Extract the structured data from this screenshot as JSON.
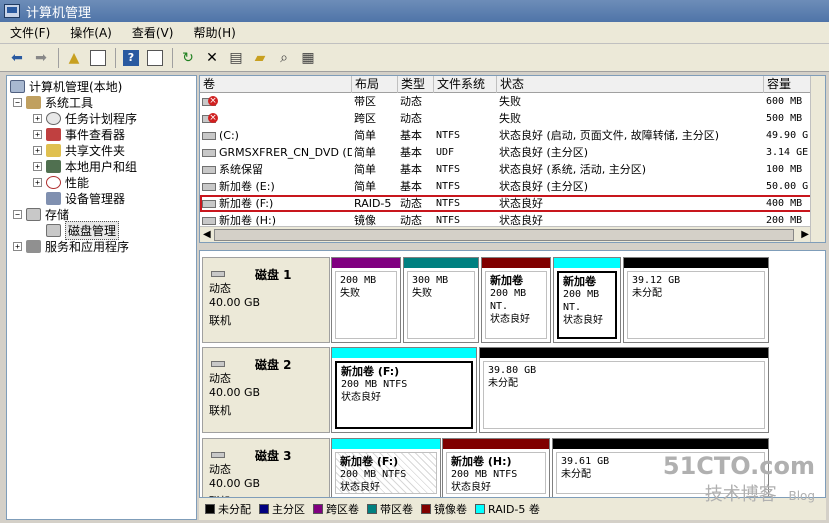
{
  "window": {
    "title": "计算机管理"
  },
  "menu": [
    "文件(F)",
    "操作(A)",
    "查看(V)",
    "帮助(H)"
  ],
  "toolbar": {
    "icons": [
      "back-arrow-icon",
      "forward-arrow-icon",
      "up-folder-icon",
      "console-tree-icon",
      "help-icon",
      "properties-pane-icon",
      "refresh-icon",
      "delete-icon",
      "properties-icon",
      "open-folder-icon",
      "search-icon",
      "export-icon"
    ]
  },
  "tree": {
    "items": [
      {
        "label": "计算机管理(本地)",
        "icon": "computer-management-icon"
      },
      {
        "label": "系统工具",
        "icon": "tools-icon",
        "expander": "−"
      },
      {
        "label": "任务计划程序",
        "icon": "clock-icon",
        "expander": "+"
      },
      {
        "label": "事件查看器",
        "icon": "event-viewer-icon",
        "expander": "+"
      },
      {
        "label": "共享文件夹",
        "icon": "shared-folder-icon",
        "expander": "+"
      },
      {
        "label": "本地用户和组",
        "icon": "users-icon",
        "expander": "+"
      },
      {
        "label": "性能",
        "icon": "performance-icon",
        "expander": "+"
      },
      {
        "label": "设备管理器",
        "icon": "device-manager-icon"
      },
      {
        "label": "存储",
        "icon": "storage-icon",
        "expander": "−"
      },
      {
        "label": "磁盘管理",
        "icon": "disk-management-icon"
      },
      {
        "label": "服务和应用程序",
        "icon": "services-icon",
        "expander": "+"
      }
    ]
  },
  "volumes": {
    "columns": [
      "卷",
      "布局",
      "类型",
      "文件系统",
      "状态",
      "容量"
    ],
    "rows": [
      {
        "name": "",
        "layout": "带区",
        "type": "动态",
        "fs": "",
        "status": "失败",
        "capacity": "600 MB",
        "error": true
      },
      {
        "name": "",
        "layout": "跨区",
        "type": "动态",
        "fs": "",
        "status": "失败",
        "capacity": "500 MB",
        "error": true
      },
      {
        "name": "(C:)",
        "layout": "简单",
        "type": "基本",
        "fs": "NTFS",
        "status": "状态良好 (启动, 页面文件, 故障转储, 主分区)",
        "capacity": "49.90 G"
      },
      {
        "name": "GRMSXFRER_CN_DVD (D:)",
        "layout": "简单",
        "type": "基本",
        "fs": "UDF",
        "status": "状态良好 (主分区)",
        "capacity": "3.14 GE"
      },
      {
        "name": "系统保留",
        "layout": "简单",
        "type": "基本",
        "fs": "NTFS",
        "status": "状态良好 (系统, 活动, 主分区)",
        "capacity": "100 MB"
      },
      {
        "name": "新加卷 (E:)",
        "layout": "简单",
        "type": "基本",
        "fs": "NTFS",
        "status": "状态良好 (主分区)",
        "capacity": "50.00 G"
      },
      {
        "name": "新加卷 (F:)",
        "layout": "RAID-5",
        "type": "动态",
        "fs": "NTFS",
        "status": "状态良好",
        "capacity": "400 MB",
        "highlighted": true
      },
      {
        "name": "新加卷 (H:)",
        "layout": "镜像",
        "type": "动态",
        "fs": "NTFS",
        "status": "状态良好",
        "capacity": "200 MB"
      }
    ]
  },
  "disks": [
    {
      "name": "磁盘 1",
      "type": "动态",
      "size": "40.00 GB",
      "state": "联机",
      "partitions": [
        {
          "title": "",
          "line1": "200 MB",
          "line2": "失败",
          "color": "#800080"
        },
        {
          "title": "",
          "line1": "300 MB",
          "line2": "失败",
          "color": "#008080"
        },
        {
          "title": "新加卷",
          "line1": "200 MB NT.",
          "line2": "状态良好",
          "color": "#800000"
        },
        {
          "title": "新加卷",
          "line1": "200 MB NT.",
          "line2": "状态良好",
          "color": "#00ffff",
          "selected": true
        },
        {
          "title": "",
          "line1": "39.12 GB",
          "line2": "未分配",
          "color": "#000000"
        }
      ]
    },
    {
      "name": "磁盘 2",
      "type": "动态",
      "size": "40.00 GB",
      "state": "联机",
      "partitions": [
        {
          "title": "新加卷 (F:)",
          "line1": "200 MB NTFS",
          "line2": "状态良好",
          "color": "#00ffff",
          "selected": true
        },
        {
          "title": "",
          "line1": "39.80 GB",
          "line2": "未分配",
          "color": "#000000"
        }
      ]
    },
    {
      "name": "磁盘 3",
      "type": "动态",
      "size": "40.00 GB",
      "state": "联机",
      "partitions": [
        {
          "title": "新加卷 (F:)",
          "line1": "200 MB NTFS",
          "line2": "状态良好",
          "color": "#00ffff",
          "hatch": true
        },
        {
          "title": "新加卷 (H:)",
          "line1": "200 MB NTFS",
          "line2": "状态良好",
          "color": "#800000"
        },
        {
          "title": "",
          "line1": "39.61 GB",
          "line2": "未分配",
          "color": "#000000"
        }
      ]
    }
  ],
  "legend": [
    {
      "label": "未分配",
      "color": "#000000"
    },
    {
      "label": "主分区",
      "color": "#000080"
    },
    {
      "label": "跨区卷",
      "color": "#800080"
    },
    {
      "label": "带区卷",
      "color": "#008080"
    },
    {
      "label": "镜像卷",
      "color": "#800000"
    },
    {
      "label": "RAID-5 卷",
      "color": "#00ffff"
    }
  ],
  "watermark": {
    "line1": "51CTO.com",
    "line2": "技术博客",
    "line3": "Blog"
  }
}
